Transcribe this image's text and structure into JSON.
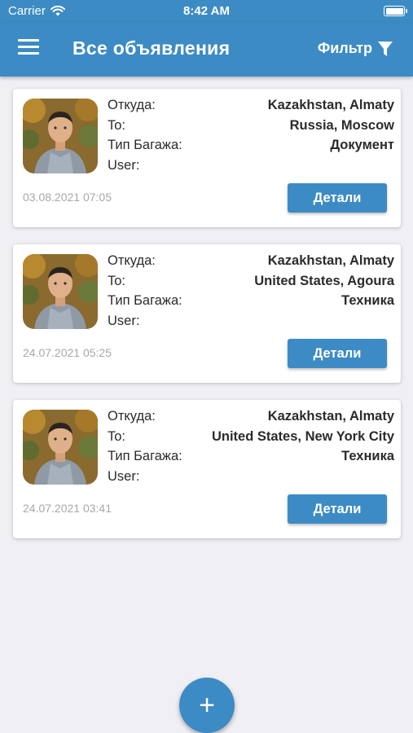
{
  "status_bar": {
    "carrier": "Carrier",
    "time": "8:42 AM",
    "wifi_icon": "wifi-icon",
    "battery_icon": "battery-icon"
  },
  "app_bar": {
    "title": "Все объявления",
    "menu_icon": "hamburger-menu-icon",
    "filter_label": "Фильтр",
    "filter_icon": "funnel-icon"
  },
  "labels": {
    "from": "Откуда:",
    "to": "To:",
    "luggage_type": "Тип Багажа:",
    "user": "User:",
    "details_button": "Детали"
  },
  "listings": [
    {
      "from": "Kazakhstan, Almaty",
      "to": "Russia, Moscow",
      "luggage_type": "Документ",
      "user": "",
      "date": "03.08.2021 07:05"
    },
    {
      "from": "Kazakhstan, Almaty",
      "to": "United States, Agoura",
      "luggage_type": "Техника",
      "user": "",
      "date": "24.07.2021 05:25"
    },
    {
      "from": "Kazakhstan, Almaty",
      "to": "United States, New York City",
      "luggage_type": "Техника",
      "user": "",
      "date": "24.07.2021 03:41"
    }
  ],
  "fab": {
    "label": "+",
    "icon": "plus-icon"
  },
  "colors": {
    "primary": "#3d8bc4",
    "background": "#efeff4",
    "card": "#ffffff",
    "date_text": "#a8a8a8"
  }
}
